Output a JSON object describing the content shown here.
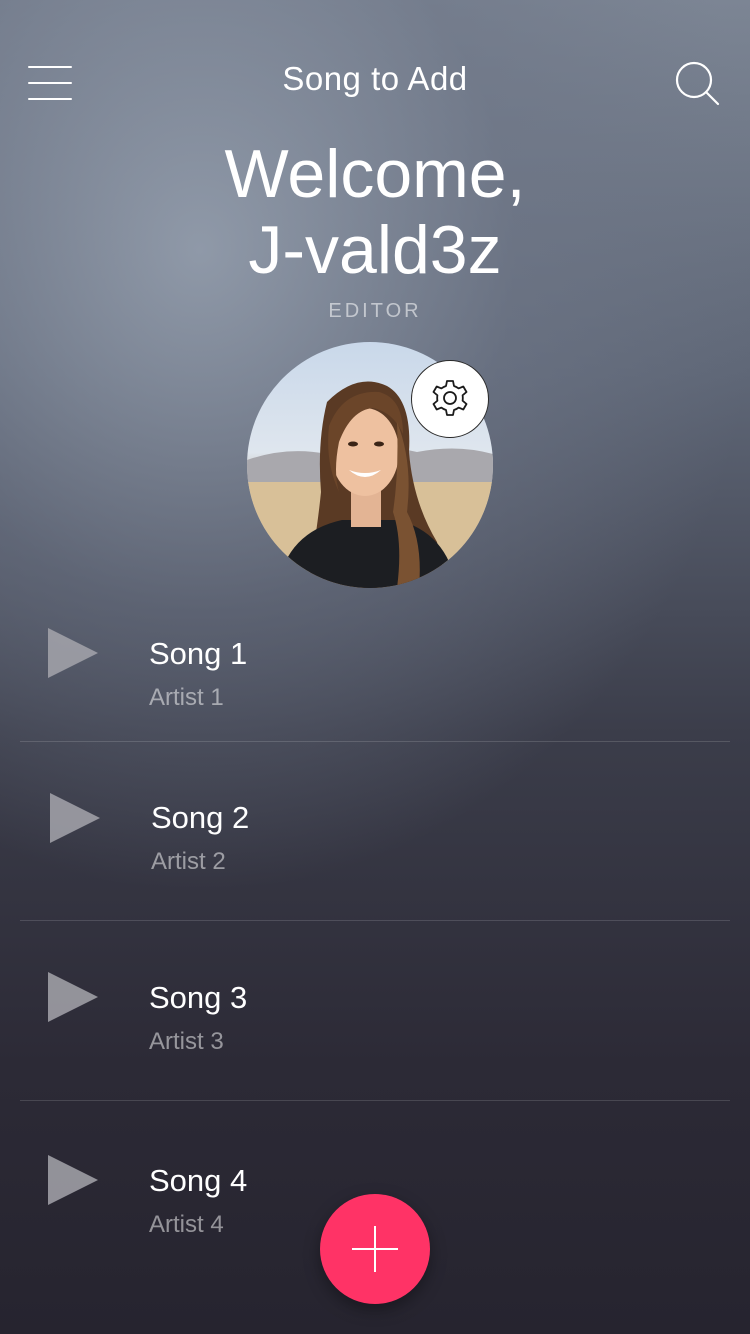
{
  "header": {
    "title": "Song to Add",
    "menu_icon": "hamburger-menu-icon",
    "search_icon": "search-icon"
  },
  "welcome": {
    "line1": "Welcome,",
    "line2": "J-vald3z",
    "role": "EDITOR"
  },
  "profile": {
    "avatar": "user-avatar-photo",
    "settings_icon": "gear-icon"
  },
  "songs": [
    {
      "title": "Song 1",
      "artist": "Artist 1"
    },
    {
      "title": "Song 2",
      "artist": "Artist 2"
    },
    {
      "title": "Song 3",
      "artist": "Artist 3"
    },
    {
      "title": "Song 4",
      "artist": "Artist 4"
    }
  ],
  "fab": {
    "icon": "plus-icon",
    "color": "#ff3366"
  }
}
